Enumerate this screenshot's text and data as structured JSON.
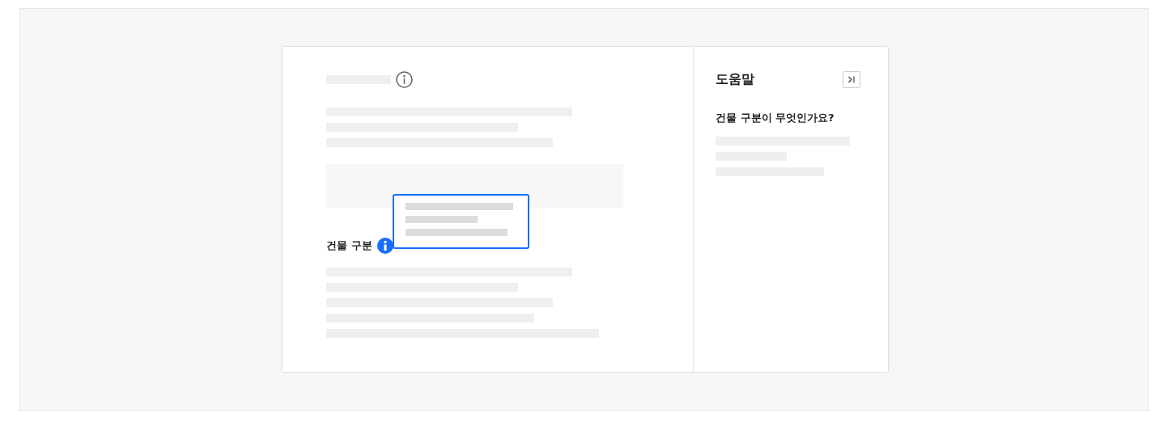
{
  "main": {
    "field_label": "건물 구분"
  },
  "help_panel": {
    "title": "도움말",
    "question": "건물 구분이 무엇인가요?"
  }
}
